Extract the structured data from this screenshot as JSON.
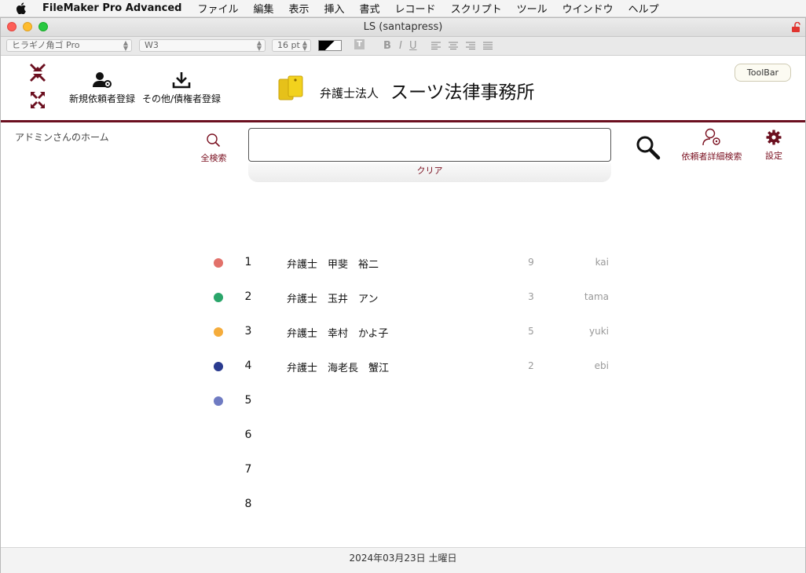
{
  "menubar": {
    "app_name": "FileMaker Pro Advanced",
    "items": [
      "ファイル",
      "編集",
      "表示",
      "挿入",
      "書式",
      "レコード",
      "スクリプト",
      "ツール",
      "ウインドウ",
      "ヘルプ"
    ]
  },
  "window": {
    "title": "LS (santapress)"
  },
  "formatbar": {
    "font_family": "ヒラギノ角ゴ Pro",
    "font_weight": "W3",
    "font_size": "16 pt"
  },
  "header": {
    "new_client_label": "新規依頼者登録",
    "other_register_label": "その他/債権者登録",
    "firm_prefix": "弁護士法人",
    "firm_name": "スーツ法律事務所",
    "toolbar_label": "ToolBar"
  },
  "main": {
    "home_label": "アドミンさんのホーム",
    "search_all_label": "全検索",
    "search_value": "",
    "clear_label": "クリア",
    "detail_search_label": "依頼者詳細検索",
    "settings_label": "設定"
  },
  "colors": {
    "accent": "#6b0f1f"
  },
  "rows": [
    {
      "num": "1",
      "color": "#e2716a",
      "name": "弁護士　甲斐　裕二",
      "count": "9",
      "uid": "kai"
    },
    {
      "num": "2",
      "color": "#2aa56a",
      "name": "弁護士　玉井　アン",
      "count": "3",
      "uid": "tama"
    },
    {
      "num": "3",
      "color": "#f5ac3b",
      "name": "弁護士　幸村　かよ子",
      "count": "5",
      "uid": "yuki"
    },
    {
      "num": "4",
      "color": "#2a3b8f",
      "name": "弁護士　海老長　蟹江",
      "count": "2",
      "uid": "ebi"
    },
    {
      "num": "5",
      "color": "#6f7bc2",
      "name": "",
      "count": "",
      "uid": ""
    },
    {
      "num": "6",
      "color": "",
      "name": "",
      "count": "",
      "uid": ""
    },
    {
      "num": "7",
      "color": "",
      "name": "",
      "count": "",
      "uid": ""
    },
    {
      "num": "8",
      "color": "",
      "name": "",
      "count": "",
      "uid": ""
    }
  ],
  "footer": {
    "date": "2024年03月23日 土曜日"
  }
}
